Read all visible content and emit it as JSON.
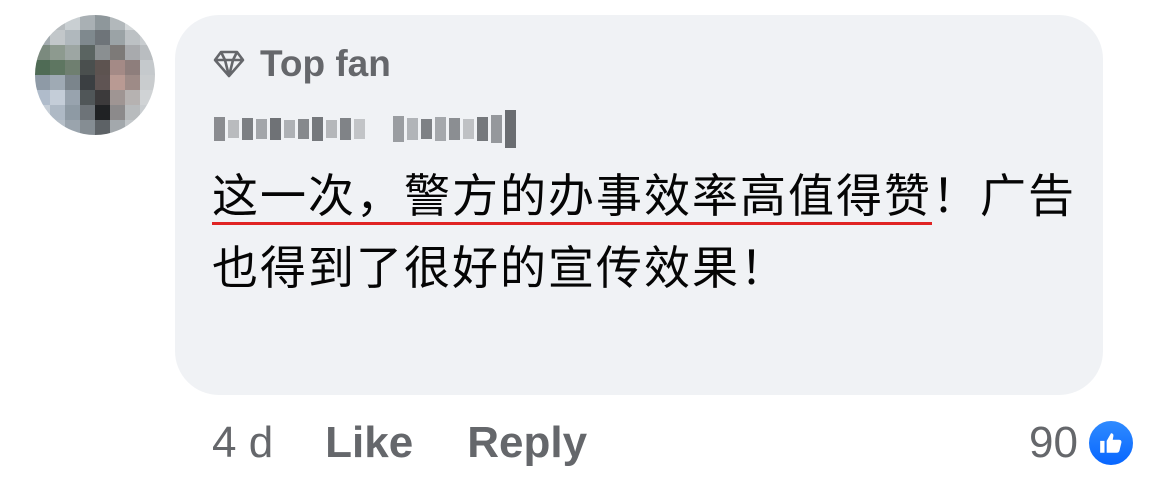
{
  "comment": {
    "badge_label": "Top fan",
    "badge_icon": "diamond-icon",
    "author_name": "",
    "text_line_underlined_1": "这一次，警方的办事效率高值得",
    "text_line_underlined_2": "赞",
    "text_rest": "！广告也得到了很好的宣传效果！",
    "underline_color": "#e02424"
  },
  "actions": {
    "timestamp": "4 d",
    "like_label": "Like",
    "reply_label": "Reply"
  },
  "reactions": {
    "count": "90",
    "icon": "thumbs-up-icon",
    "color": "#0866ff"
  }
}
